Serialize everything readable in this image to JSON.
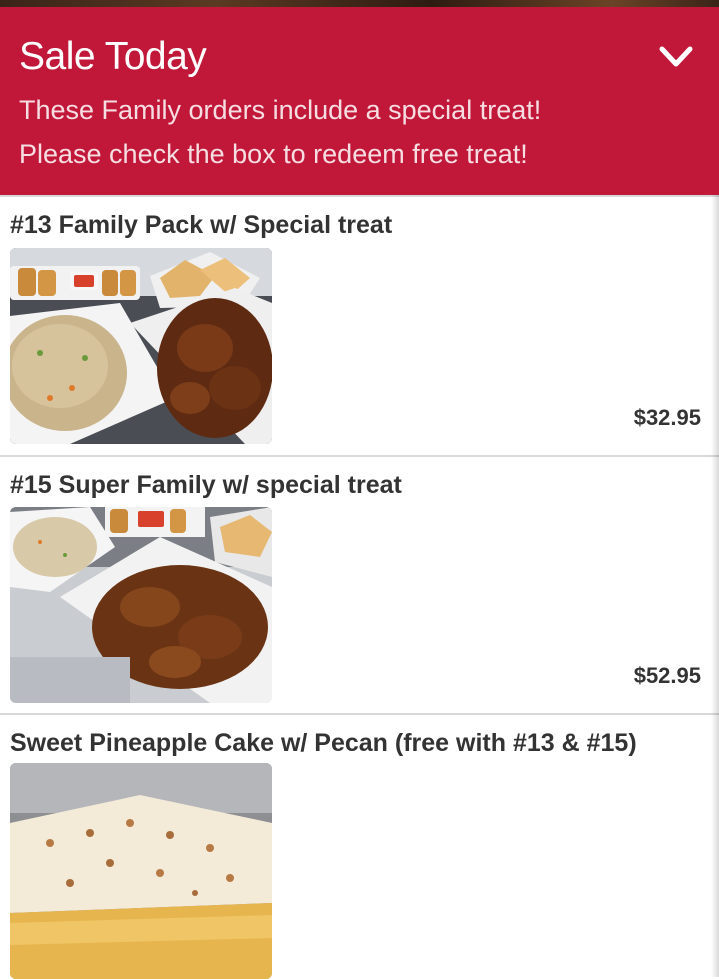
{
  "banner": {
    "title": "Sale Today",
    "line1": "These Family orders include a special treat!",
    "line2": "Please check the box to redeem free treat!",
    "toggle_icon": "chevron-down-icon",
    "bg_color": "#c1183a"
  },
  "items": [
    {
      "name": "#13 Family Pack w/ Special treat",
      "price": "$32.95"
    },
    {
      "name": "#15 Super Family w/ special treat",
      "price": "$52.95"
    },
    {
      "name": "Sweet Pineapple Cake w/ Pecan (free with #13 & #15)"
    }
  ]
}
